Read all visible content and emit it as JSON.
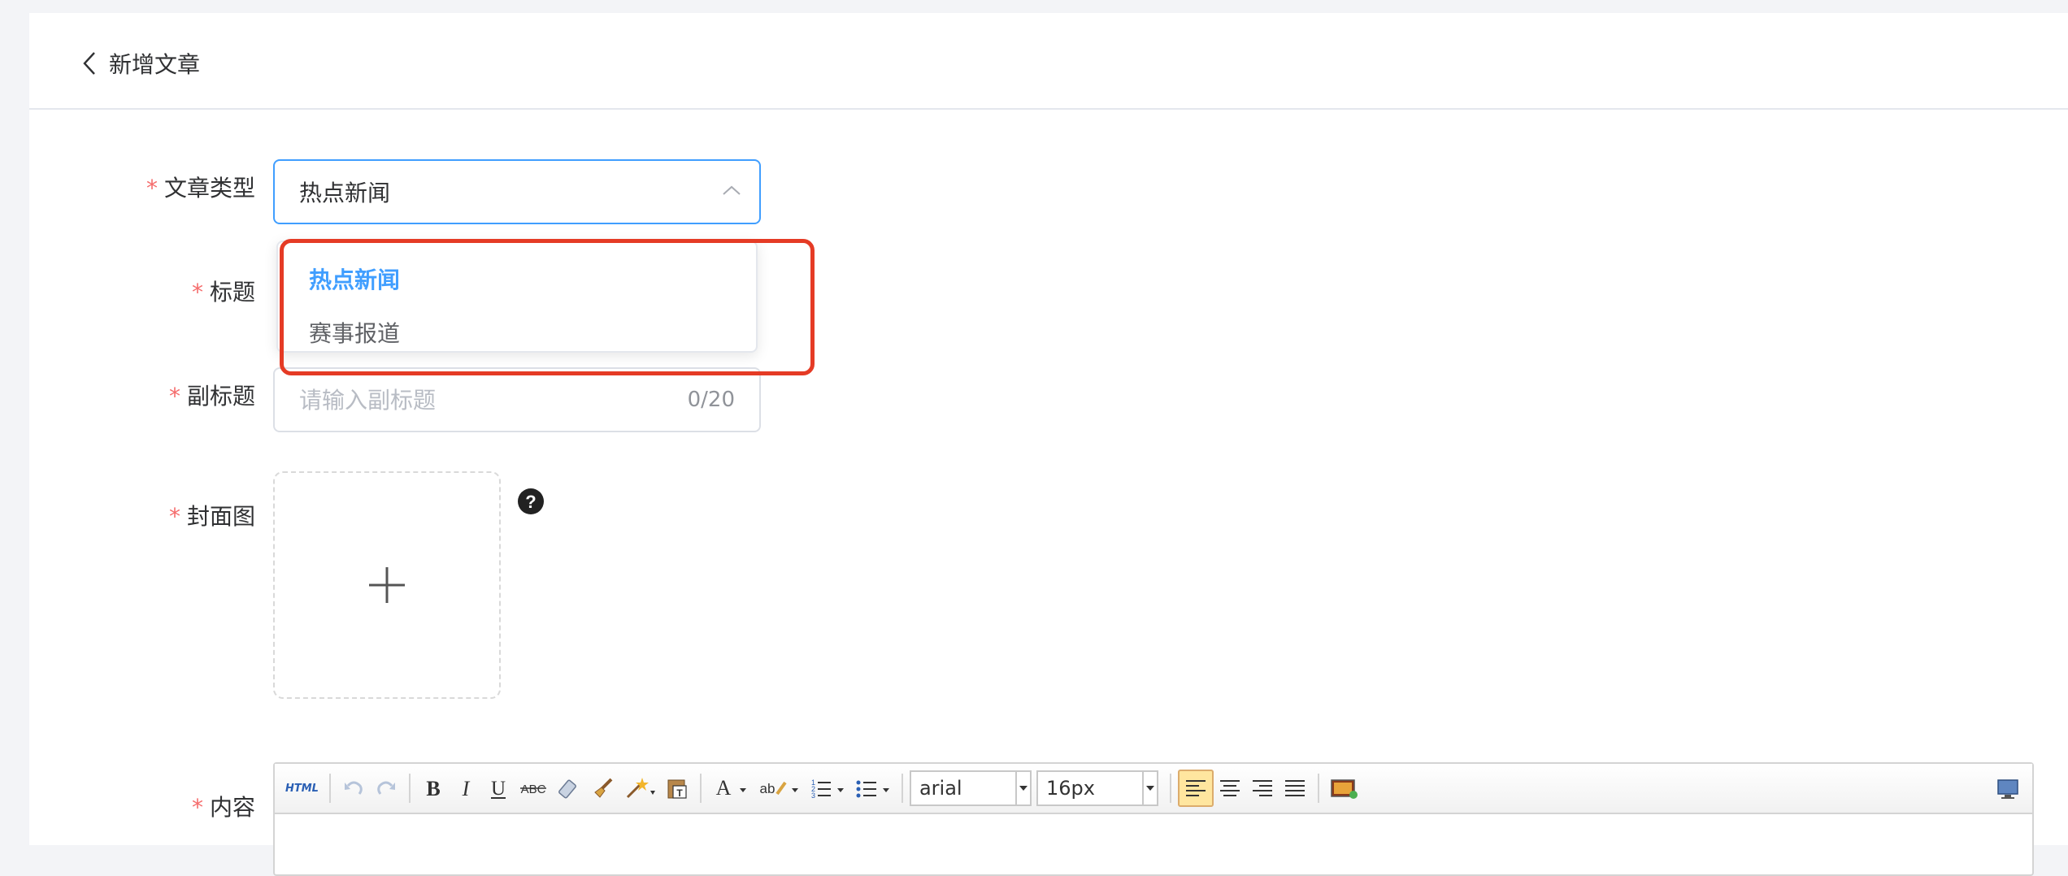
{
  "header": {
    "title": "新增文章"
  },
  "form": {
    "article_type": {
      "label": "文章类型",
      "value": "热点新闻",
      "options": [
        "热点新闻",
        "赛事报道"
      ]
    },
    "title": {
      "label": "标题"
    },
    "subtitle": {
      "label": "副标题",
      "placeholder": "请输入副标题",
      "count": "0/20"
    },
    "cover": {
      "label": "封面图"
    },
    "content": {
      "label": "内容"
    },
    "required_mark": "*"
  },
  "editor_toolbar": {
    "html_label": "HTML",
    "font_family": "arial",
    "font_size": "16px",
    "active_align": "left"
  },
  "colors": {
    "primary": "#409eff",
    "required": "#f56c6c",
    "highlight": "#e53b25"
  }
}
